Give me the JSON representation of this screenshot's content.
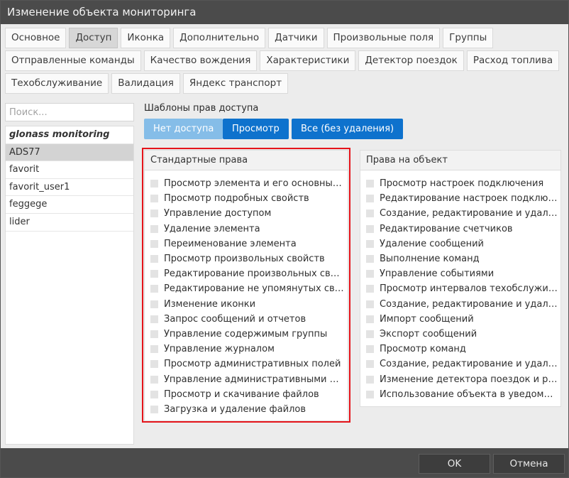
{
  "window": {
    "title": "Изменение объекта мониторинга"
  },
  "tabs": {
    "row1": [
      "Основное",
      "Доступ",
      "Иконка",
      "Дополнительно",
      "Датчики",
      "Произвольные поля",
      "Группы"
    ],
    "row2": [
      "Отправленные команды",
      "Качество вождения",
      "Характеристики",
      "Детектор поездок",
      "Расход топлива"
    ],
    "row3": [
      "Техобслуживание",
      "Валидация",
      "Яндекс транспорт"
    ],
    "active": "Доступ"
  },
  "search": {
    "placeholder": "Поиск..."
  },
  "users": [
    {
      "name": "glonass monitoring",
      "kind": "group"
    },
    {
      "name": "ADS77",
      "kind": "selected"
    },
    {
      "name": "favorit",
      "kind": "normal"
    },
    {
      "name": "favorit_user1",
      "kind": "normal"
    },
    {
      "name": "feggege",
      "kind": "normal"
    },
    {
      "name": "lider",
      "kind": "normal"
    }
  ],
  "templates": {
    "label": "Шаблоны прав доступа",
    "no_access": "Нет доступа",
    "view": "Просмотр",
    "all": "Все (без удаления)"
  },
  "standard_rights": {
    "title": "Стандартные права",
    "items": [
      "Просмотр элемента и его основных свойств",
      "Просмотр подробных свойств",
      "Управление доступом",
      "Удаление элемента",
      "Переименование элемента",
      "Просмотр произвольных свойств",
      "Редактирование произвольных свойств",
      "Редактирование не упомянутых свойств",
      "Изменение иконки",
      "Запрос сообщений и отчетов",
      "Управление содержимым группы",
      "Управление журналом",
      "Просмотр административных полей",
      "Управление административными полями",
      "Просмотр и скачивание файлов",
      "Загрузка и удаление файлов"
    ]
  },
  "object_rights": {
    "title": "Права на объект",
    "items": [
      "Просмотр настроек подключения",
      "Редактирование настроек подключения",
      "Создание, редактирование и удаление датчиков",
      "Редактирование счетчиков",
      "Удаление сообщений",
      "Выполнение команд",
      "Управление событиями",
      "Просмотр интервалов техобслуживания",
      "Создание, редактирование и удаление интервалов",
      "Импорт сообщений",
      "Экспорт сообщений",
      "Просмотр команд",
      "Создание, редактирование и удаление команд",
      "Изменение детектора поездок и расхода топлива",
      "Использование объекта в уведомлениях"
    ]
  },
  "footer": {
    "ok": "OK",
    "cancel": "Отмена"
  }
}
